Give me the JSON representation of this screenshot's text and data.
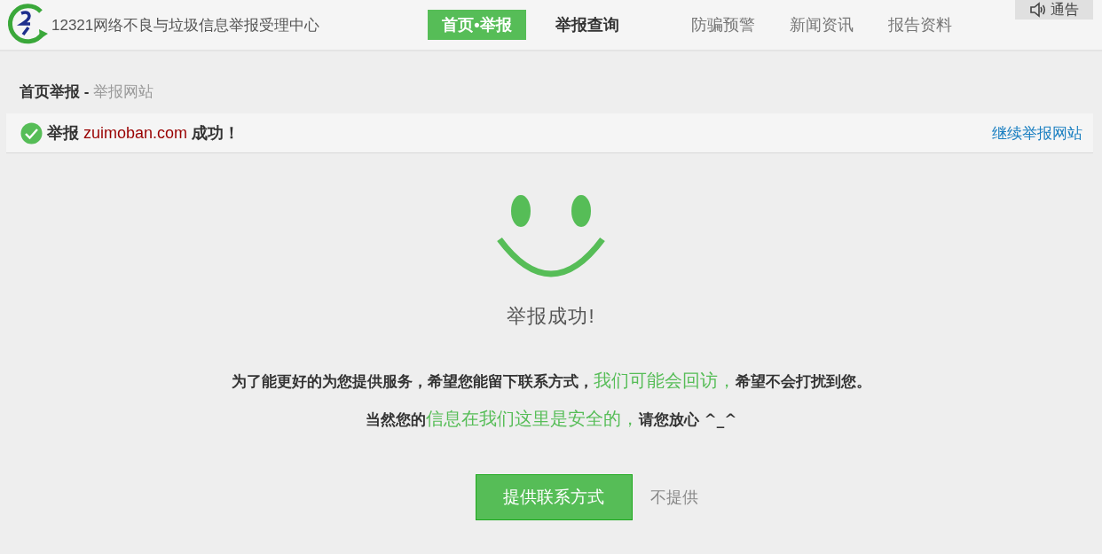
{
  "header": {
    "site_name": "12321网络不良与垃圾信息举报受理中心",
    "nav": [
      {
        "label": "首页•举报",
        "selected": true,
        "kind": "primary"
      },
      {
        "label": "举报查询",
        "selected": false,
        "kind": "primary"
      },
      {
        "label": "防骗预警",
        "selected": false,
        "kind": "secondary"
      },
      {
        "label": "新闻资讯",
        "selected": false,
        "kind": "secondary"
      },
      {
        "label": "报告资料",
        "selected": false,
        "kind": "secondary"
      }
    ],
    "notice_button": "通告"
  },
  "breadcrumb": {
    "current": "首页举报",
    "separator": "-",
    "sub": "举报网站"
  },
  "result_bar": {
    "prefix": "举报",
    "site": "zuimoban.com",
    "suffix": "成功！",
    "link": "继续举报网站"
  },
  "success_title": "举报成功!",
  "message_lines": [
    [
      {
        "text": "为了能更好的为您提供服务，希望您能留下联系方式，",
        "highlight": false
      },
      {
        "text": "我们可能会回访，",
        "highlight": true
      },
      {
        "text": "希望不会打扰到您。",
        "highlight": false
      }
    ],
    [
      {
        "text": "当然您的",
        "highlight": false
      },
      {
        "text": "信息在我们这里是安全的，",
        "highlight": true
      },
      {
        "text": "请您放心 ^_^",
        "highlight": false
      }
    ]
  ],
  "actions": {
    "primary": "提供联系方式",
    "secondary": "不提供"
  }
}
